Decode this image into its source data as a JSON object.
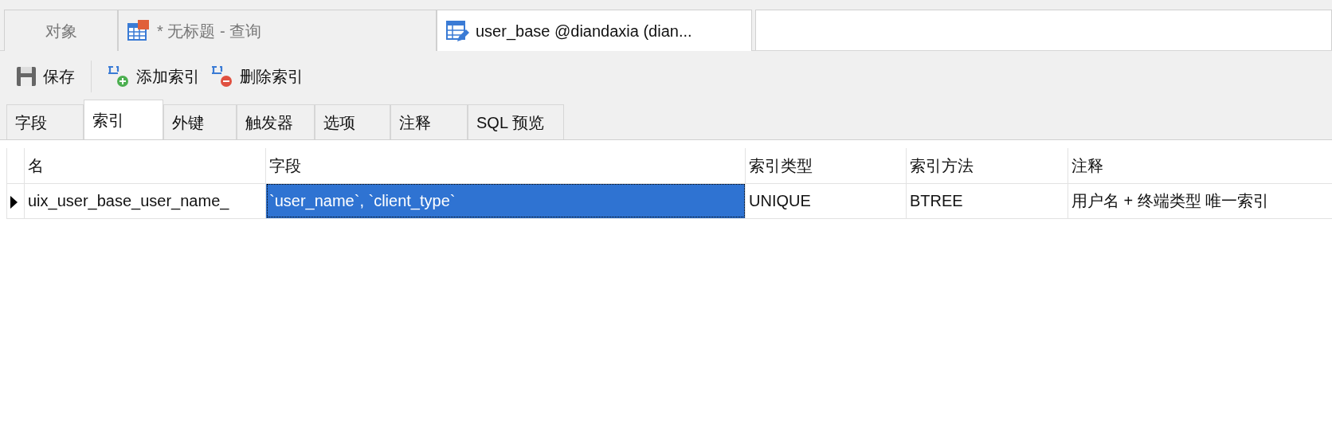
{
  "doc_tabs": [
    {
      "label": "对象",
      "kind": "plain",
      "selected": false
    },
    {
      "label": "* 无标题 - 查询",
      "kind": "query",
      "selected": false
    },
    {
      "label": "user_base @diandaxia (dian...",
      "kind": "table",
      "selected": true
    }
  ],
  "toolbar": [
    {
      "label": "保存",
      "kind": "save"
    },
    {
      "label": "添加索引",
      "kind": "add"
    },
    {
      "label": "删除索引",
      "kind": "remove"
    }
  ],
  "tabs": [
    {
      "label": "字段",
      "selected": false
    },
    {
      "label": "索引",
      "selected": true
    },
    {
      "label": "外键",
      "selected": false
    },
    {
      "label": "触发器",
      "selected": false
    },
    {
      "label": "选项",
      "selected": false
    },
    {
      "label": "注释",
      "selected": false
    },
    {
      "label": "SQL 预览",
      "selected": false
    }
  ],
  "table": {
    "columns": [
      "名",
      "字段",
      "索引类型",
      "索引方法",
      "注释"
    ],
    "rows": [
      {
        "current": true,
        "cells": [
          {
            "text": "uix_user_base_user_name_",
            "selected": false
          },
          {
            "text": "`user_name`, `client_type`",
            "selected": true
          },
          {
            "text": "UNIQUE",
            "selected": false
          },
          {
            "text": "BTREE",
            "selected": false
          },
          {
            "text": "用户名 + 终端类型 唯一索引",
            "selected": false
          }
        ]
      }
    ]
  }
}
